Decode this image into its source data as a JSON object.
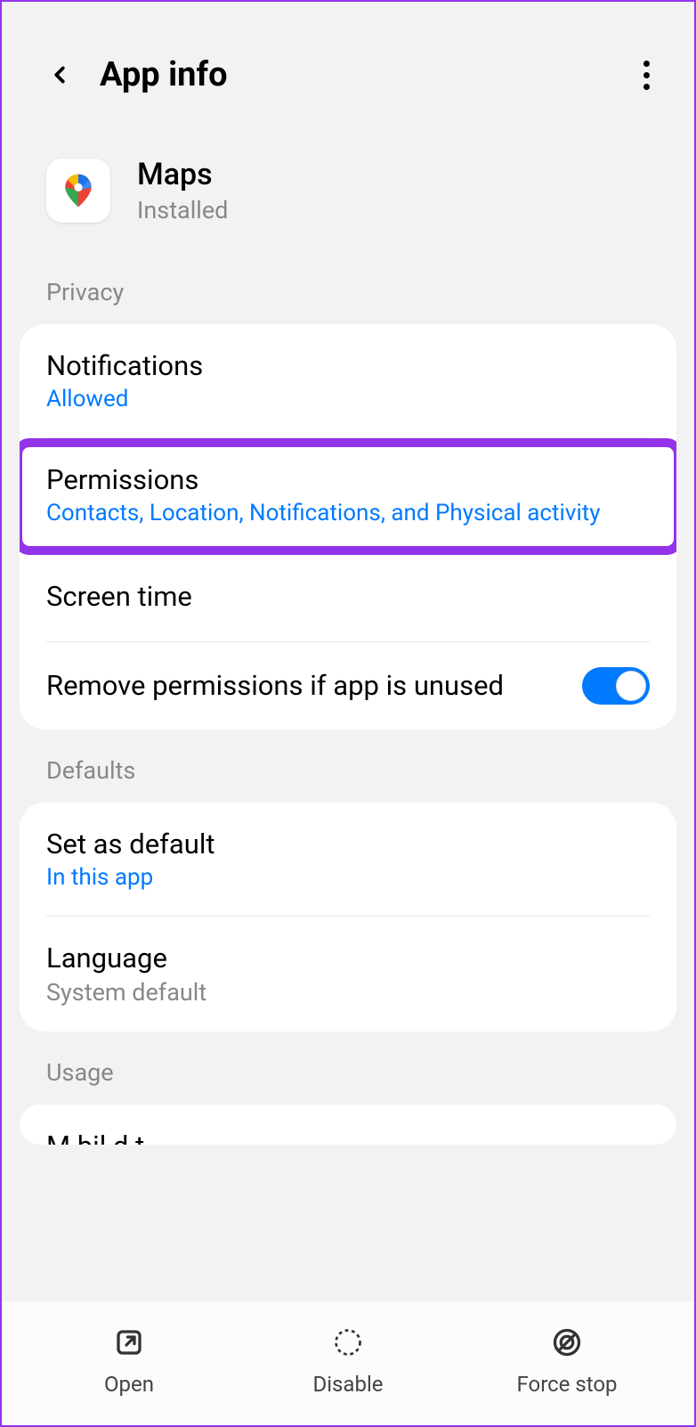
{
  "header": {
    "title": "App info"
  },
  "app": {
    "name": "Maps",
    "status": "Installed"
  },
  "sections": {
    "privacy": {
      "label": "Privacy",
      "notifications": {
        "title": "Notifications",
        "value": "Allowed"
      },
      "permissions": {
        "title": "Permissions",
        "value": "Contacts, Location, Notifications, and Physical activity"
      },
      "screenTime": {
        "title": "Screen time"
      },
      "removePermissions": {
        "title": "Remove permissions if app is unused",
        "enabled": true
      }
    },
    "defaults": {
      "label": "Defaults",
      "setDefault": {
        "title": "Set as default",
        "value": "In this app"
      },
      "language": {
        "title": "Language",
        "value": "System default"
      }
    },
    "usage": {
      "label": "Usage",
      "mobileData": {
        "title": "Mobile data"
      }
    }
  },
  "bottomBar": {
    "open": "Open",
    "disable": "Disable",
    "forceStop": "Force stop"
  }
}
